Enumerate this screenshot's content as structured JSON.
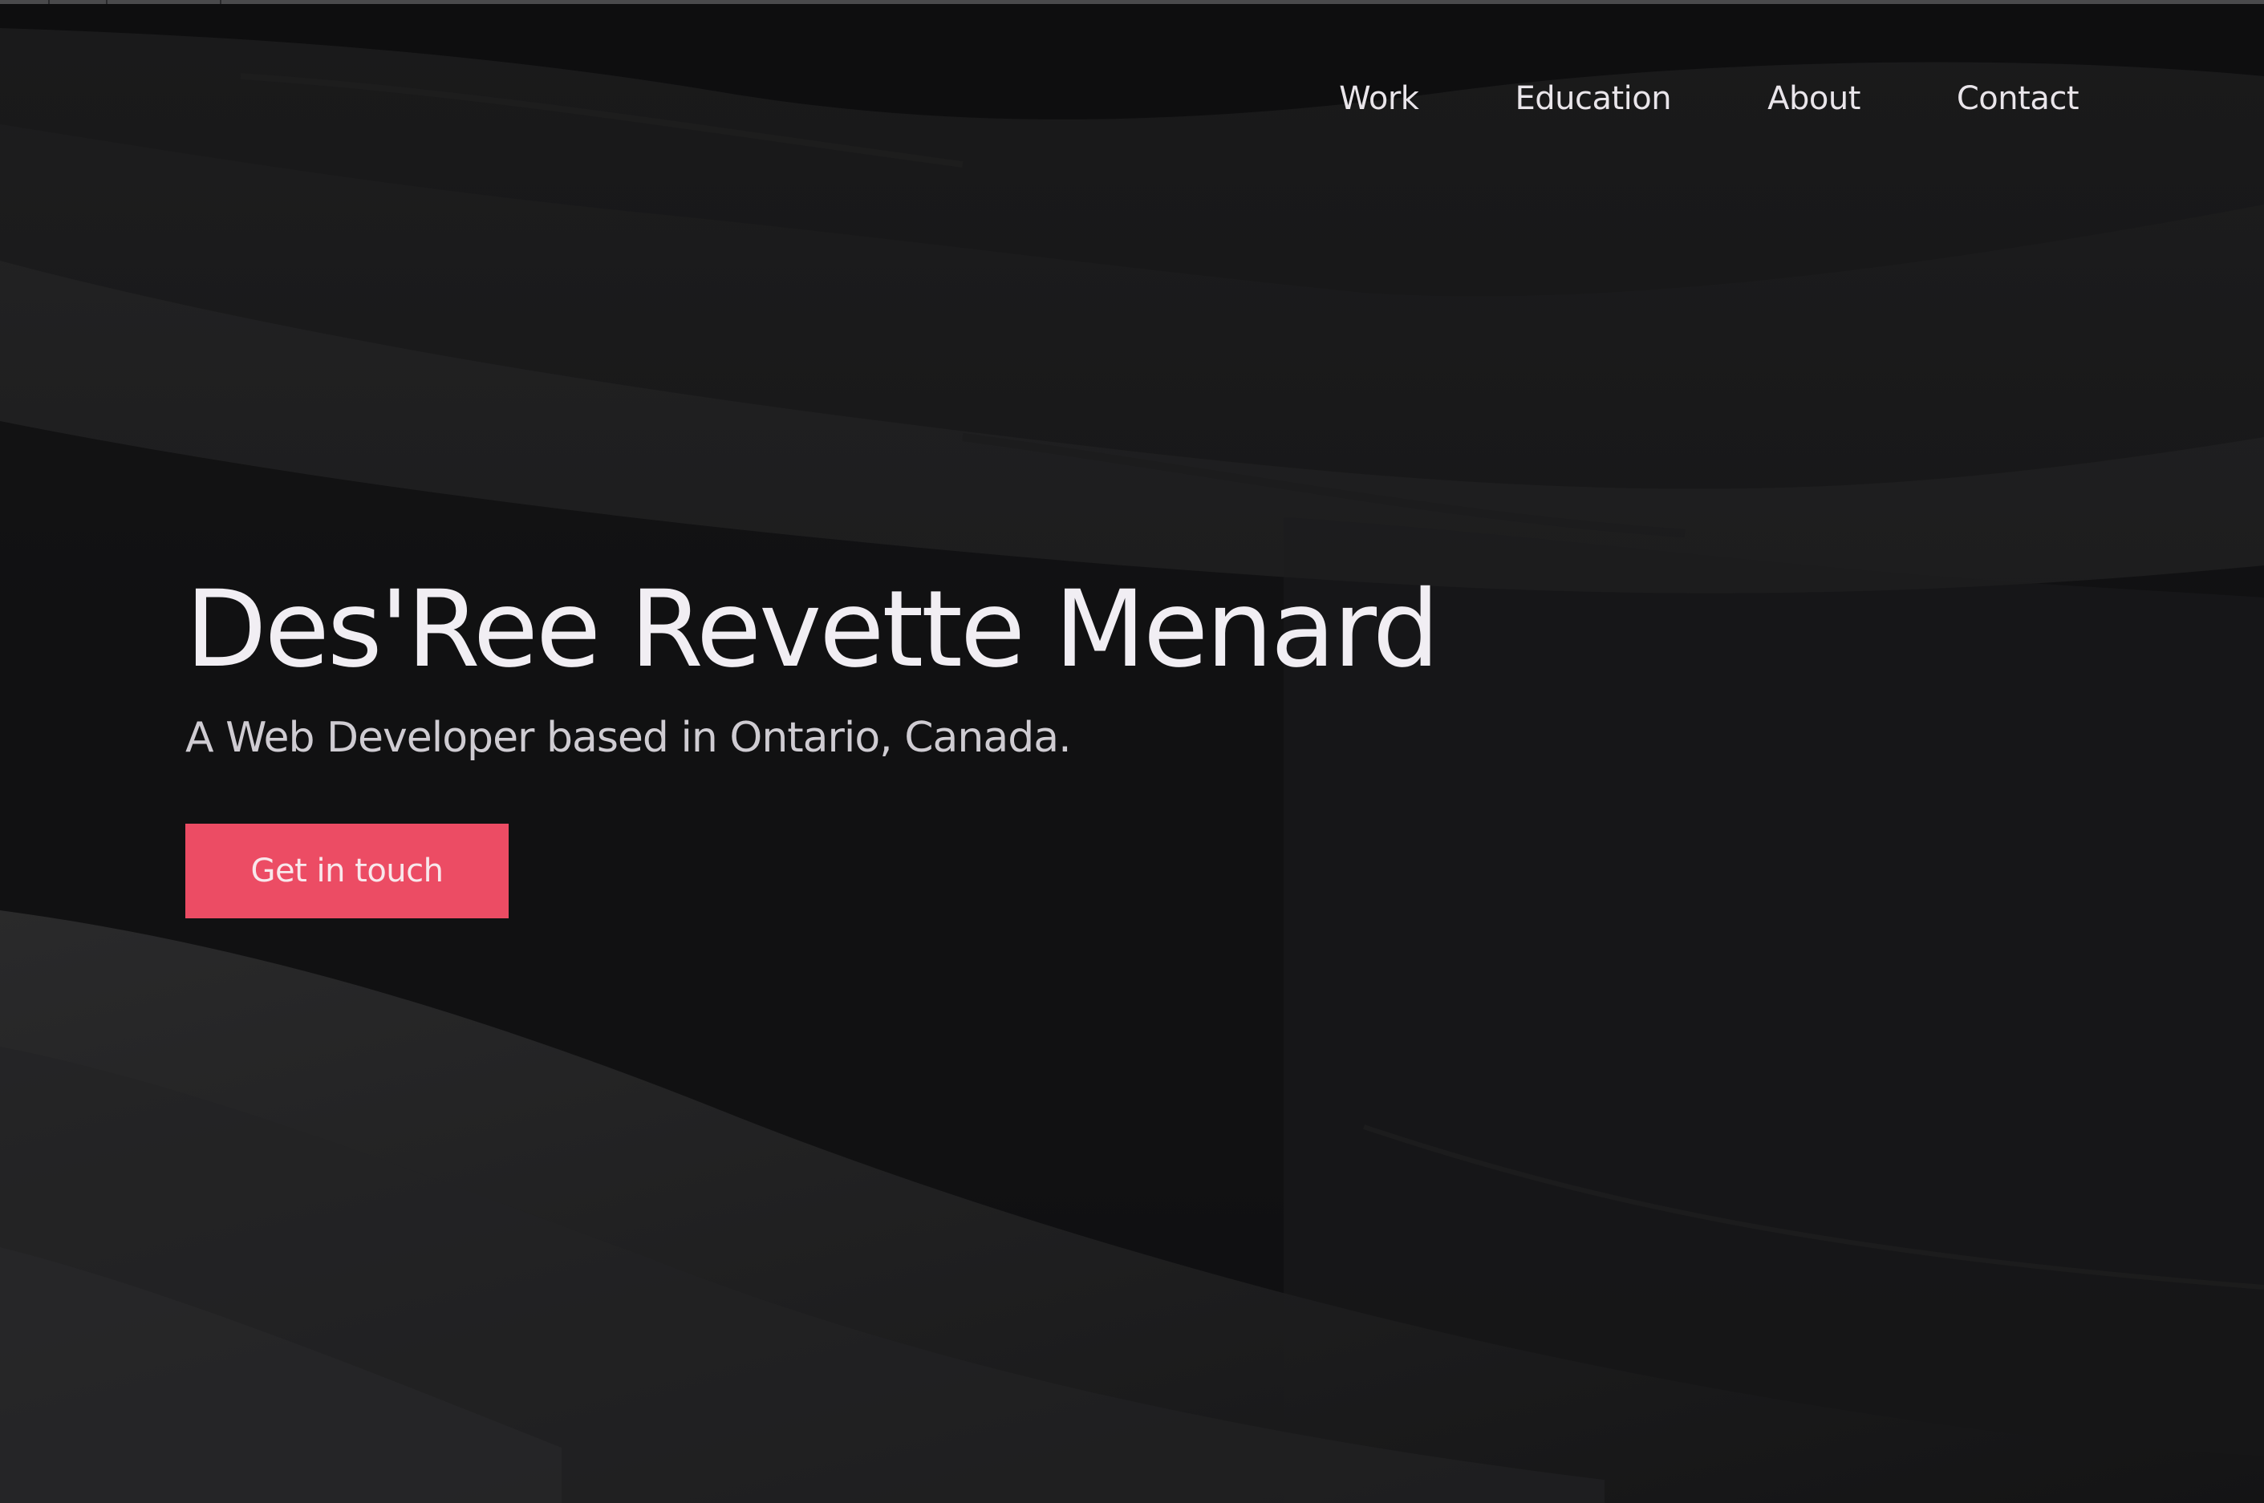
{
  "nav": {
    "items": [
      {
        "label": "Work"
      },
      {
        "label": "Education"
      },
      {
        "label": "About"
      },
      {
        "label": "Contact"
      }
    ]
  },
  "hero": {
    "title": "Des'Ree Revette Menard",
    "subtitle": "A Web Developer based in Ontario, Canada.",
    "cta_label": "Get in touch"
  },
  "colors": {
    "accent": "#ec4c64",
    "background": "#0b0b0c",
    "text": "#f1eef3"
  }
}
